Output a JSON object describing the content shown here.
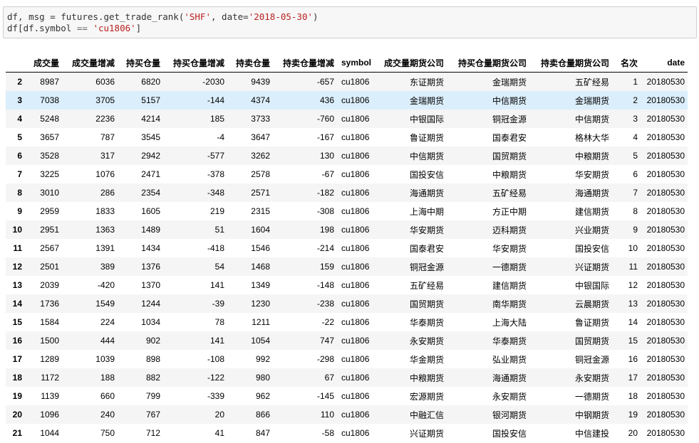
{
  "code": {
    "line1": {
      "pre": "df, msg = futures.get_trade_rank(",
      "arg1": "'SHF'",
      "mid": ", date=",
      "arg2": "'2018-05-30'",
      "post": ")"
    },
    "line2": {
      "pre": "df[df.symbol ",
      "op": "==",
      "sp": " ",
      "arg": "'cu1806'",
      "post": "]"
    }
  },
  "table": {
    "columns": [
      "",
      "成交量",
      "成交量增减",
      "持买仓量",
      "持买仓量增减",
      "持卖仓量",
      "持卖仓量增减",
      "symbol",
      "成交量期货公司",
      "持买仓量期货公司",
      "持卖仓量期货公司",
      "名次",
      "date"
    ],
    "selected_row": 1,
    "rows": [
      [
        "2",
        "8987",
        "6036",
        "6820",
        "-2030",
        "9439",
        "-657",
        "cu1806",
        "东证期货",
        "金瑞期货",
        "五矿经易",
        "1",
        "20180530"
      ],
      [
        "3",
        "7038",
        "3705",
        "5157",
        "-144",
        "4374",
        "436",
        "cu1806",
        "金瑞期货",
        "中信期货",
        "金瑞期货",
        "2",
        "20180530"
      ],
      [
        "4",
        "5248",
        "2236",
        "4214",
        "185",
        "3733",
        "-760",
        "cu1806",
        "中银国际",
        "铜冠金源",
        "中信期货",
        "3",
        "20180530"
      ],
      [
        "5",
        "3657",
        "787",
        "3545",
        "-4",
        "3647",
        "-167",
        "cu1806",
        "鲁证期货",
        "国泰君安",
        "格林大华",
        "4",
        "20180530"
      ],
      [
        "6",
        "3528",
        "317",
        "2942",
        "-577",
        "3262",
        "130",
        "cu1806",
        "中信期货",
        "国贸期货",
        "中粮期货",
        "5",
        "20180530"
      ],
      [
        "7",
        "3225",
        "1076",
        "2471",
        "-378",
        "2578",
        "-67",
        "cu1806",
        "国投安信",
        "中粮期货",
        "华安期货",
        "6",
        "20180530"
      ],
      [
        "8",
        "3010",
        "286",
        "2354",
        "-348",
        "2571",
        "-182",
        "cu1806",
        "海通期货",
        "五矿经易",
        "海通期货",
        "7",
        "20180530"
      ],
      [
        "9",
        "2959",
        "1833",
        "1605",
        "219",
        "2315",
        "-308",
        "cu1806",
        "上海中期",
        "方正中期",
        "建信期货",
        "8",
        "20180530"
      ],
      [
        "10",
        "2951",
        "1363",
        "1489",
        "51",
        "1604",
        "198",
        "cu1806",
        "华安期货",
        "迈科期货",
        "兴业期货",
        "9",
        "20180530"
      ],
      [
        "11",
        "2567",
        "1391",
        "1434",
        "-418",
        "1546",
        "-214",
        "cu1806",
        "国泰君安",
        "华安期货",
        "国投安信",
        "10",
        "20180530"
      ],
      [
        "12",
        "2501",
        "389",
        "1376",
        "54",
        "1468",
        "159",
        "cu1806",
        "铜冠金源",
        "一德期货",
        "兴证期货",
        "11",
        "20180530"
      ],
      [
        "13",
        "2039",
        "-420",
        "1370",
        "141",
        "1349",
        "-148",
        "cu1806",
        "五矿经易",
        "建信期货",
        "中银国际",
        "12",
        "20180530"
      ],
      [
        "14",
        "1736",
        "1549",
        "1244",
        "-39",
        "1230",
        "-238",
        "cu1806",
        "国贸期货",
        "南华期货",
        "云晨期货",
        "13",
        "20180530"
      ],
      [
        "15",
        "1584",
        "224",
        "1034",
        "78",
        "1211",
        "-22",
        "cu1806",
        "华泰期货",
        "上海大陆",
        "鲁证期货",
        "14",
        "20180530"
      ],
      [
        "16",
        "1500",
        "444",
        "902",
        "141",
        "1054",
        "747",
        "cu1806",
        "永安期货",
        "华泰期货",
        "国贸期货",
        "15",
        "20180530"
      ],
      [
        "17",
        "1289",
        "1039",
        "898",
        "-108",
        "992",
        "-298",
        "cu1806",
        "华金期货",
        "弘业期货",
        "铜冠金源",
        "16",
        "20180530"
      ],
      [
        "18",
        "1172",
        "188",
        "882",
        "-122",
        "980",
        "67",
        "cu1806",
        "中粮期货",
        "海通期货",
        "永安期货",
        "17",
        "20180530"
      ],
      [
        "19",
        "1139",
        "660",
        "799",
        "-339",
        "962",
        "-145",
        "cu1806",
        "宏源期货",
        "永安期货",
        "一德期货",
        "18",
        "20180530"
      ],
      [
        "20",
        "1096",
        "240",
        "767",
        "20",
        "866",
        "110",
        "cu1806",
        "中融汇信",
        "银河期货",
        "中钢期货",
        "19",
        "20180530"
      ],
      [
        "21",
        "1044",
        "750",
        "712",
        "41",
        "847",
        "-58",
        "cu1806",
        "兴证期货",
        "国投安信",
        "中信建投",
        "20",
        "20180530"
      ]
    ]
  }
}
